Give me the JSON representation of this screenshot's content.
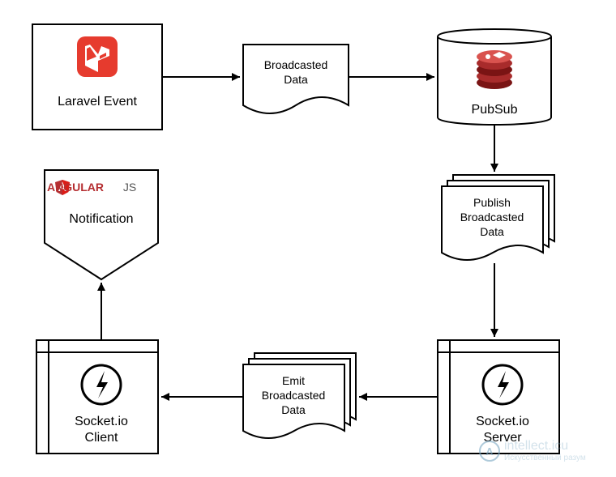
{
  "nodes": {
    "laravel_event": {
      "label": "Laravel Event"
    },
    "broadcasted_data": {
      "line1": "Broadcasted",
      "line2": "Data"
    },
    "pubsub": {
      "label": "PubSub"
    },
    "publish_broadcasted_data": {
      "line1": "Publish",
      "line2": "Broadcasted",
      "line3": "Data"
    },
    "socket_server": {
      "line1": "Socket.io",
      "line2": "Server"
    },
    "emit_broadcasted_data": {
      "line1": "Emit",
      "line2": "Broadcasted",
      "line3": "Data"
    },
    "socket_client": {
      "line1": "Socket.io",
      "line2": "Client"
    },
    "notification": {
      "brand1": "ANGULAR",
      "brand2": "JS",
      "label": "Notification"
    }
  },
  "watermark": {
    "main": "intellect.icu",
    "sub": "Искусственный разум"
  },
  "chart_data": {
    "type": "diagram",
    "nodes": [
      {
        "id": "laravel_event",
        "label": "Laravel Event",
        "shape": "process"
      },
      {
        "id": "broadcasted_data",
        "label": "Broadcasted Data",
        "shape": "document"
      },
      {
        "id": "pubsub",
        "label": "PubSub",
        "shape": "database"
      },
      {
        "id": "publish_broadcasted_data",
        "label": "Publish Broadcasted Data",
        "shape": "multi-document"
      },
      {
        "id": "socket_server",
        "label": "Socket.io Server",
        "shape": "internal-storage"
      },
      {
        "id": "emit_broadcasted_data",
        "label": "Emit Broadcasted Data",
        "shape": "multi-document"
      },
      {
        "id": "socket_client",
        "label": "Socket.io Client",
        "shape": "internal-storage"
      },
      {
        "id": "notification",
        "label": "AngularJS Notification",
        "shape": "off-page-connector"
      }
    ],
    "edges": [
      {
        "from": "laravel_event",
        "to": "broadcasted_data"
      },
      {
        "from": "broadcasted_data",
        "to": "pubsub"
      },
      {
        "from": "pubsub",
        "to": "publish_broadcasted_data"
      },
      {
        "from": "publish_broadcasted_data",
        "to": "socket_server"
      },
      {
        "from": "socket_server",
        "to": "emit_broadcasted_data"
      },
      {
        "from": "emit_broadcasted_data",
        "to": "socket_client"
      },
      {
        "from": "socket_client",
        "to": "notification"
      }
    ]
  }
}
